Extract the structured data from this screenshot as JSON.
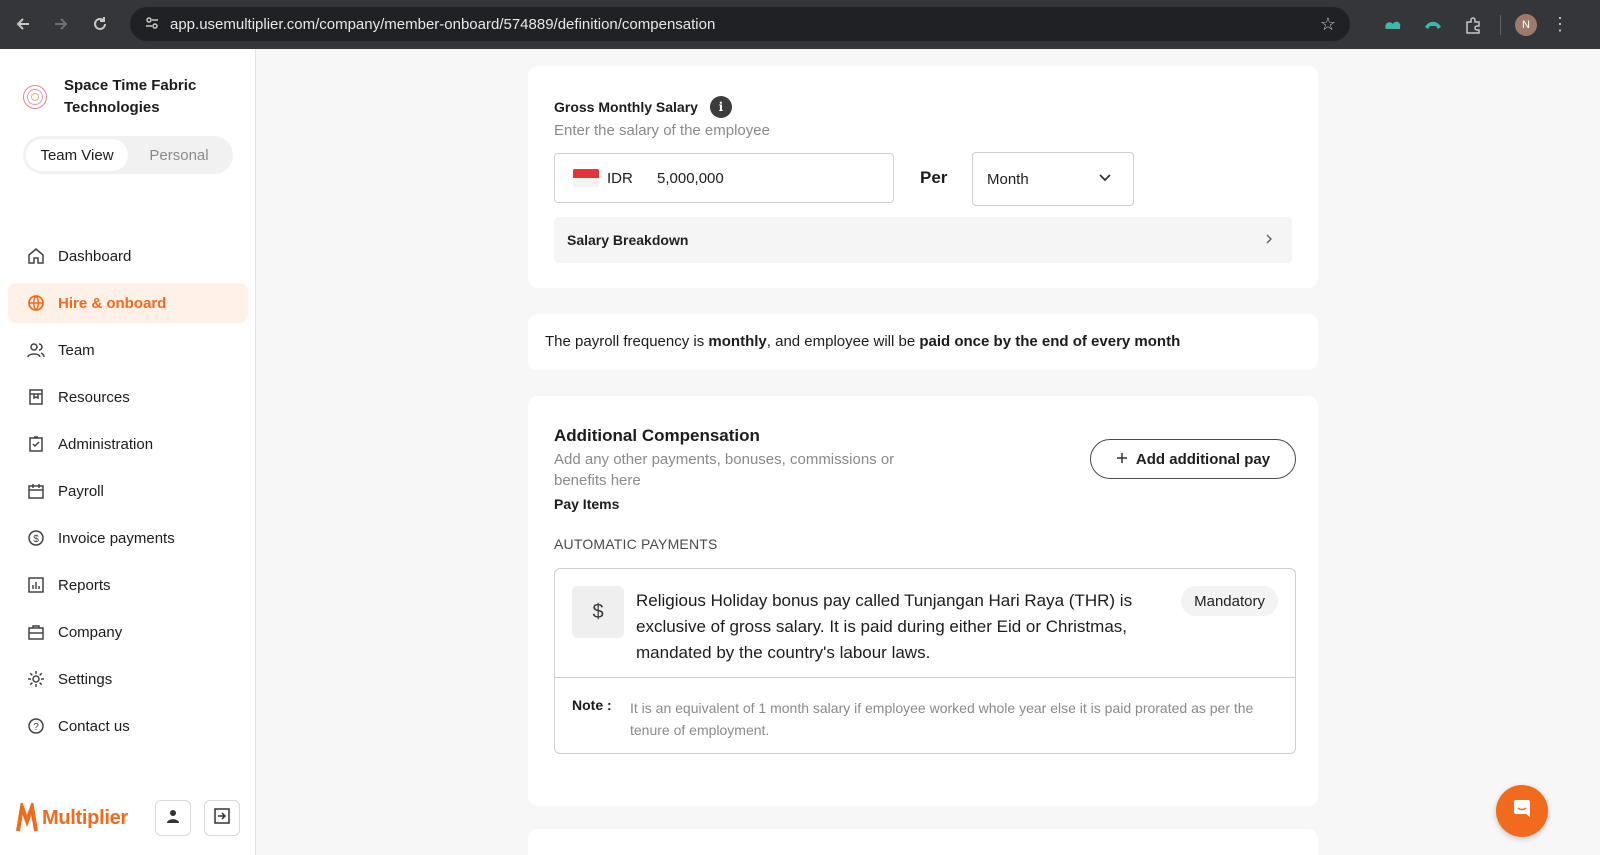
{
  "browser": {
    "url": "app.usemultiplier.com/company/member-onboard/574889/definition/compensation",
    "profile_initial": "N"
  },
  "sidebar": {
    "company_name": "Space Time Fabric Technologies",
    "view_toggle": {
      "team": "Team View",
      "personal": "Personal",
      "active": "team"
    },
    "items": [
      {
        "label": "Dashboard",
        "icon": "home-icon"
      },
      {
        "label": "Hire & onboard",
        "icon": "globe-icon",
        "active": true
      },
      {
        "label": "Team",
        "icon": "people-icon"
      },
      {
        "label": "Resources",
        "icon": "book-icon"
      },
      {
        "label": "Administration",
        "icon": "checklist-icon"
      },
      {
        "label": "Payroll",
        "icon": "calendar-icon"
      },
      {
        "label": "Invoice payments",
        "icon": "dollar-circle-icon"
      },
      {
        "label": "Reports",
        "icon": "report-chart-icon"
      },
      {
        "label": "Company",
        "icon": "briefcase-icon"
      },
      {
        "label": "Settings",
        "icon": "gear-icon"
      },
      {
        "label": "Contact us",
        "icon": "help-circle-icon"
      }
    ],
    "brand_name": "Multiplier",
    "accent_color": "#f26a1b"
  },
  "salary": {
    "label": "Gross Monthly Salary",
    "subtitle": "Enter the salary of the employee",
    "currency": "IDR",
    "amount": "5,000,000",
    "per_label": "Per",
    "period": "Month",
    "breakdown_label": "Salary Breakdown"
  },
  "payroll": {
    "prefix": "The payroll frequency is ",
    "frequency": "monthly",
    "middle": ", and employee will be ",
    "schedule": "paid once by the end of every month"
  },
  "additional": {
    "title": "Additional Compensation",
    "subtitle": "Add any other payments, bonuses, commissions or benefits here",
    "add_button": "Add additional pay",
    "pay_items_label": "Pay Items",
    "automatic_label": "AUTOMATIC PAYMENTS",
    "item": {
      "description": "Religious Holiday bonus pay called Tunjangan Hari Raya (THR) is exclusive of gross salary. It is paid during either Eid or Christmas, mandated by the country's labour laws.",
      "badge": "Mandatory",
      "note_label": "Note :",
      "note_text": "It is an equivalent of 1 month salary if employee worked whole year else it is paid prorated as per the tenure of employment."
    }
  }
}
